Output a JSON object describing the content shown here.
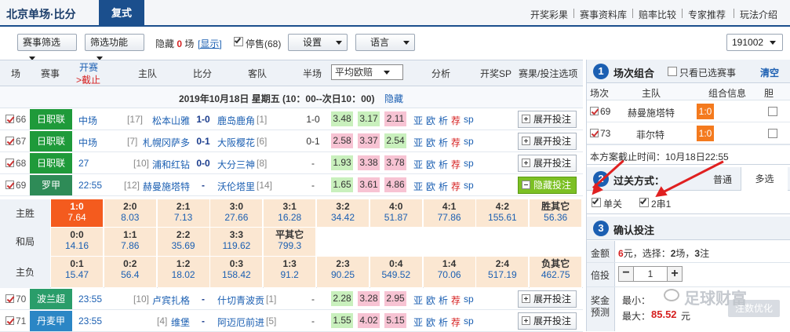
{
  "topbar": {
    "brand": "北京单场·比分",
    "active_tab": "复式",
    "links": [
      "开奖彩果",
      "赛事资料库",
      "赔率比较",
      "专家推荐",
      "玩法介绍"
    ]
  },
  "toolbar": {
    "match_filter": "赛事筛选",
    "filter_func": "筛选功能",
    "hidden_label": "隐藏",
    "hidden_count": "0",
    "hidden_unit": "场",
    "show_link": "[显示]",
    "stopped_label": "停售(68)",
    "settings": "设置",
    "language": "语言",
    "issue": "191002"
  },
  "table_header": {
    "col_no": "场",
    "col_league": "赛事",
    "col_open": "开赛",
    "col_deadline": ">截止",
    "col_home": "主队",
    "col_score": "比分",
    "col_away": "客队",
    "col_half": "半场",
    "odds_select": "平均欧赔",
    "col_analysis": "分析",
    "col_sp": "开奖SP",
    "col_result": "赛果/投注选项"
  },
  "date_line": {
    "text": "2019年10月18日 星期五 (10：00--次日10：00)",
    "hide": "隐藏"
  },
  "matches": [
    {
      "no": "66",
      "league": "日职联",
      "league_color": "#1f9a3a",
      "time": "中场",
      "home_rank": "[17]",
      "home": "松本山雅",
      "score": "1-0",
      "away": "鹿岛鹿角",
      "away_rank": "[1]",
      "half": "1-0",
      "o1": "3.48",
      "o2": "3.17",
      "o3": "2.11",
      "o1c": "g",
      "o2c": "g",
      "o3c": "p",
      "a1": "亚",
      "a2": "欧",
      "a3": "析",
      "a4": "荐",
      "a5": "sp",
      "action": "展开投注"
    },
    {
      "no": "67",
      "league": "日职联",
      "league_color": "#1f9a3a",
      "time": "中场",
      "home_rank": "[7]",
      "home": "札幌冈萨多",
      "score": "0-1",
      "away": "大阪樱花",
      "away_rank": "[6]",
      "half": "0-1",
      "o1": "2.58",
      "o2": "3.37",
      "o3": "2.54",
      "o1c": "p",
      "o2c": "p",
      "o3c": "g",
      "a1": "亚",
      "a2": "欧",
      "a3": "析",
      "a4": "荐",
      "a5": "sp",
      "action": "展开投注"
    },
    {
      "no": "68",
      "league": "日职联",
      "league_color": "#1f9a3a",
      "time": "27",
      "home_rank": "[10]",
      "home": "浦和红钻",
      "score": "0-0",
      "away": "大分三神",
      "away_rank": "[8]",
      "half": "-",
      "o1": "1.93",
      "o2": "3.38",
      "o3": "3.78",
      "o1c": "g",
      "o2c": "p",
      "o3c": "p",
      "a1": "亚",
      "a2": "欧",
      "a3": "析",
      "a4": "荐",
      "a5": "sp",
      "action": "展开投注"
    },
    {
      "no": "69",
      "league": "罗甲",
      "league_color": "#2e8b57",
      "time": "22:55",
      "home_rank": "[12]",
      "home": "赫曼施塔特",
      "score": "-",
      "away": "沃伦塔里",
      "away_rank": "[14]",
      "half": "-",
      "o1": "1.65",
      "o2": "3.61",
      "o3": "4.86",
      "o1c": "g",
      "o2c": "p",
      "o3c": "p",
      "a1": "亚",
      "a2": "欧",
      "a3": "析",
      "a4": "荐",
      "a5": "sp",
      "action": "隐藏投注"
    },
    {
      "no": "70",
      "league": "波兰超",
      "league_color": "#2a9d6a",
      "time": "23:55",
      "home_rank": "[10]",
      "home": "卢宾扎格",
      "score": "-",
      "away": "什切青波贡",
      "away_rank": "[1]",
      "half": "-",
      "o1": "2.28",
      "o2": "3.28",
      "o3": "2.95",
      "o1c": "g",
      "o2c": "p",
      "o3c": "p",
      "a1": "亚",
      "a2": "欧",
      "a3": "析",
      "a4": "荐",
      "a5": "sp",
      "action": "展开投注"
    },
    {
      "no": "71",
      "league": "丹麦甲",
      "league_color": "#2b86c5",
      "time": "23:55",
      "home_rank": "[4]",
      "home": "维堡",
      "score": "-",
      "away": "阿迈厄前进",
      "away_rank": "[5]",
      "half": "-",
      "o1": "1.55",
      "o2": "4.02",
      "o3": "5.15",
      "o1c": "g",
      "o2c": "p",
      "o3c": "p",
      "a1": "亚",
      "a2": "欧",
      "a3": "析",
      "a4": "荐",
      "a5": "sp",
      "action": "展开投注"
    }
  ],
  "grid": {
    "win_label": "主胜",
    "draw_label": "和局",
    "lose_label": "主负",
    "win": [
      [
        "1:0",
        "7.64"
      ],
      [
        "2:0",
        "8.03"
      ],
      [
        "2:1",
        "7.13"
      ],
      [
        "3:0",
        "27.66"
      ],
      [
        "3:1",
        "16.28"
      ],
      [
        "3:2",
        "34.42"
      ],
      [
        "4:0",
        "51.87"
      ],
      [
        "4:1",
        "77.86"
      ],
      [
        "4:2",
        "155.61"
      ],
      [
        "胜其它",
        "56.36"
      ]
    ],
    "draw": [
      [
        "0:0",
        "14.16"
      ],
      [
        "1:1",
        "7.86"
      ],
      [
        "2:2",
        "35.69"
      ],
      [
        "3:3",
        "119.62"
      ],
      [
        "平其它",
        "799.3"
      ]
    ],
    "lose": [
      [
        "0:1",
        "15.47"
      ],
      [
        "0:2",
        "56.4"
      ],
      [
        "1:2",
        "18.02"
      ],
      [
        "0:3",
        "158.42"
      ],
      [
        "1:3",
        "91.2"
      ],
      [
        "2:3",
        "90.25"
      ],
      [
        "0:4",
        "549.52"
      ],
      [
        "1:4",
        "70.06"
      ],
      [
        "2:4",
        "517.19"
      ],
      [
        "负其它",
        "462.75"
      ]
    ]
  },
  "panel": {
    "s1_num": "1",
    "s1_title": "场次组合",
    "only_selected": "只看已选赛事",
    "clear": "清空",
    "col_no": "场次",
    "col_home": "主队",
    "col_info": "组合信息",
    "col_dan": "胆",
    "picks": [
      {
        "no": "69",
        "home": "赫曼施塔特",
        "info": "1:0"
      },
      {
        "no": "73",
        "home": "菲尔特",
        "info": "1:0"
      }
    ],
    "deadline": "本方案截止时间：10月18日22:55",
    "s2_num": "2",
    "s2_title": "过关方式：",
    "tab_normal": "普通",
    "tab_multi": "多选",
    "opt_single": "单关",
    "opt_2x1": "2串1",
    "s3_num": "3",
    "s3_title": "确认投注",
    "amount_label": "金额",
    "amount_val": "6",
    "amount_mid": "元，选择：",
    "amount_games": "2",
    "amount_games_unit": "场，",
    "amount_bets": "3",
    "amount_bets_unit": "注",
    "multi_label": "倍投",
    "multi_val": "1",
    "prize_label1": "奖金",
    "prize_label2": "预测",
    "min_label": "最小：",
    "max_label": "最大：",
    "max_val": "85.52",
    "max_unit": "元",
    "optimize": "注数优化",
    "watermark": "足球财富"
  }
}
